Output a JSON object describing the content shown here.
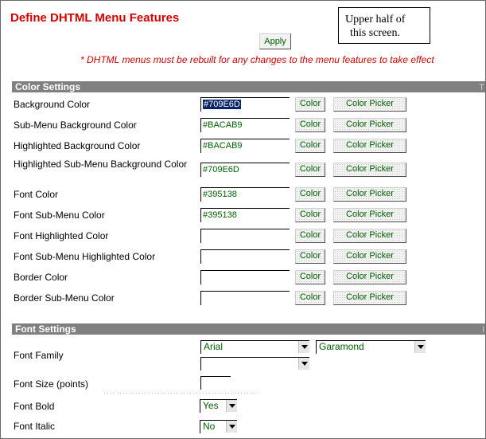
{
  "page": {
    "title": "Define DHTML Menu Features",
    "note": [
      "Upper half of",
      "this screen."
    ],
    "apply_label": "Apply",
    "warning": "* DHTML menus must be rebuilt for any changes to the menu features to take effect"
  },
  "color_settings": {
    "header": "Color Settings",
    "header_edge": "T",
    "color_button_label": "Color",
    "picker_button_label": "Color Picker",
    "rows": [
      {
        "label": "Background Color",
        "value": "#709E6D"
      },
      {
        "label": "Sub-Menu Background Color",
        "value": "#BACAB9"
      },
      {
        "label": "Highlighted Background Color",
        "value": "#BACAB9"
      },
      {
        "label": "Highlighted Sub-Menu Background Color",
        "value": "#709E6D"
      },
      {
        "label": "Font Color",
        "value": "#395138"
      },
      {
        "label": "Font Sub-Menu Color",
        "value": "#395138"
      },
      {
        "label": "Font Highlighted Color",
        "value": ""
      },
      {
        "label": "Font Sub-Menu Highlighted Color",
        "value": ""
      },
      {
        "label": "Border Color",
        "value": ""
      },
      {
        "label": "Border Sub-Menu Color",
        "value": ""
      }
    ]
  },
  "font_settings": {
    "header": "Font Settings",
    "header_edge": "I",
    "font_family_label": "Font Family",
    "font_family_primary": "Arial",
    "font_family_secondary": "Garamond",
    "font_family_tertiary": "",
    "font_size_label": "Font Size (points)",
    "font_size_value": "",
    "font_bold_label": "Font Bold",
    "font_bold_value": "Yes",
    "font_italic_label": "Font Italic",
    "font_italic_value": "No"
  }
}
